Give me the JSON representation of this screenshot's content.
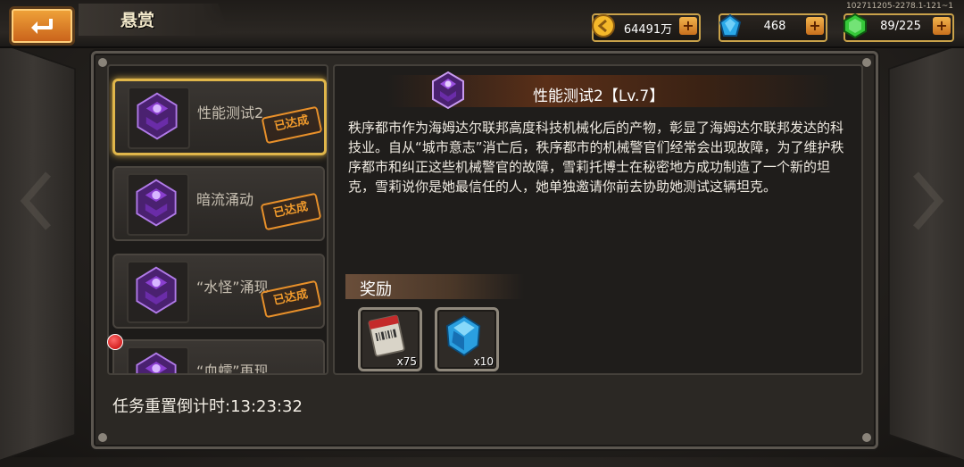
{
  "header": {
    "title": "悬赏",
    "build_info": "102711205-2278.1-121~1",
    "back_icon": "back-arrow-icon"
  },
  "resources": {
    "gold": {
      "value": "64491万",
      "icon": "gold-coin-icon"
    },
    "gems": {
      "value": "468",
      "icon": "blue-gem-icon"
    },
    "energy": {
      "value": "89/225",
      "icon": "green-energy-icon"
    },
    "plus_label": "+"
  },
  "quest_list": [
    {
      "name": "性能测试2",
      "status": "已达成",
      "selected": true
    },
    {
      "name": "暗流涌动",
      "status": "已达成",
      "selected": false
    },
    {
      "name": "“水怪”涌现",
      "status": "已达成",
      "selected": false
    },
    {
      "name": "“血蠕”再现",
      "status": "",
      "selected": false
    }
  ],
  "detail": {
    "title": "性能测试2【Lv.7】",
    "description": "秩序都市作为海姆达尔联邦高度科技机械化后的产物，彰显了海姆达尔联邦发达的科技业。自从“城市意志”消亡后，秩序都市的机械警官们经常会出现故障，为了维护秩序都市和纠正这些机械警官的故障，雪莉托博士在秘密地方成功制造了一个新的坦克，雪莉说你是她最信任的人，她单独邀请你前去协助她测试这辆坦克。",
    "reward_label": "奖励",
    "rewards": [
      {
        "icon": "blueprint-scroll-icon",
        "qty": "x75"
      },
      {
        "icon": "blue-crystal-icon",
        "qty": "x10"
      }
    ]
  },
  "footer": {
    "timer_text": "任务重置倒计时:13:23:32"
  },
  "colors": {
    "accent_gold": "#e0b64a",
    "stamp_orange": "#f09a2c",
    "emblem_purple": "#8a3fd0"
  }
}
